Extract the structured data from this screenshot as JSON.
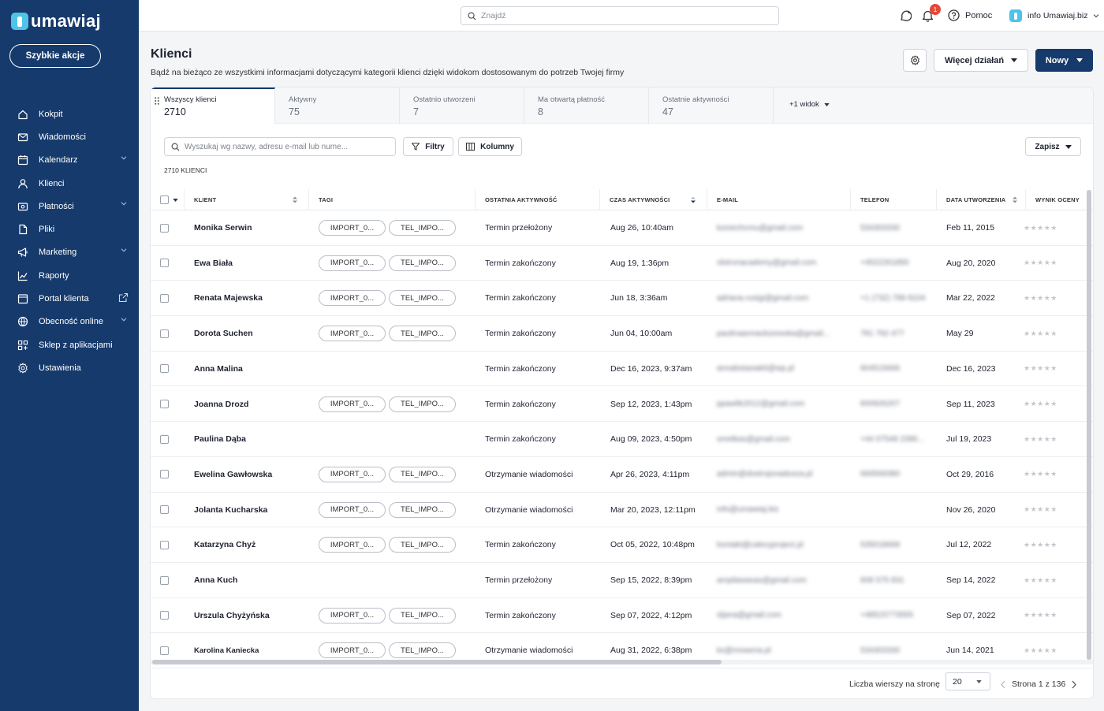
{
  "brand": {
    "name": "umawiaj"
  },
  "sidebar": {
    "quick_actions": "Szybkie akcje",
    "items": [
      {
        "label": "Kokpit",
        "icon": "home-icon"
      },
      {
        "label": "Wiadomości",
        "icon": "mail-icon"
      },
      {
        "label": "Kalendarz",
        "icon": "calendar-icon",
        "expandable": true
      },
      {
        "label": "Klienci",
        "icon": "user-icon"
      },
      {
        "label": "Płatności",
        "icon": "payment-icon",
        "expandable": true
      },
      {
        "label": "Pliki",
        "icon": "file-icon"
      },
      {
        "label": "Marketing",
        "icon": "megaphone-icon",
        "expandable": true
      },
      {
        "label": "Raporty",
        "icon": "chart-icon"
      },
      {
        "label": "Portal klienta",
        "icon": "portal-icon",
        "external": true
      },
      {
        "label": "Obecność online",
        "icon": "globe-icon",
        "expandable": true
      },
      {
        "label": "Sklep z aplikacjami",
        "icon": "apps-icon"
      },
      {
        "label": "Ustawienia",
        "icon": "gear-icon"
      }
    ]
  },
  "topbar": {
    "search_placeholder": "Znajdź",
    "notifications_count": "1",
    "help_label": "Pomoc",
    "account_label": "info Umawiaj.biz"
  },
  "header": {
    "title": "Klienci",
    "subtitle": "Bądź na bieżąco ze wszystkimi informacjami dotyczącymi kategorii klienci dzięki widokom dostosowanym do potrzeb Twojej firmy",
    "more_actions": "Więcej działań",
    "new_label": "Nowy"
  },
  "tabs": [
    {
      "label": "Wszyscy klienci",
      "count": "2710"
    },
    {
      "label": "Aktywny",
      "count": "75"
    },
    {
      "label": "Ostatnio utworzeni",
      "count": "7"
    },
    {
      "label": "Ma otwartą płatność",
      "count": "8"
    },
    {
      "label": "Ostatnie aktywności",
      "count": "47"
    }
  ],
  "tab_more": "+1 widok",
  "toolbar": {
    "search_placeholder": "Wyszukaj wg nazwy, adresu e-mail lub nume...",
    "filters": "Filtry",
    "columns": "Kolumny",
    "save": "Zapisz",
    "count_label": "2710 KLIENCI"
  },
  "table": {
    "headers": [
      "KLIENT",
      "TAGI",
      "OSTATNIA AKTYWNOŚĆ",
      "CZAS AKTYWNOŚCI",
      "E-MAIL",
      "TELEFON",
      "DATA UTWORZENIA",
      "WYNIK OCENY"
    ],
    "tag_a": "IMPORT_0...",
    "tag_b": "TEL_IMPO...",
    "stars": "★★★★★",
    "rows": [
      {
        "name": "Monika Serwin",
        "tags": true,
        "activity": "Termin przełożony",
        "time": "Aug 26, 10:40am",
        "email": "koniechcmu@gmail.com",
        "phone": "534303330",
        "created": "Feb 11, 2015"
      },
      {
        "name": "Ewa Biała",
        "tags": true,
        "activity": "Termin zakończony",
        "time": "Aug 19, 1:36pm",
        "email": "olstronacademy@gmail.com",
        "phone": "+4522261850",
        "created": "Aug 20, 2020"
      },
      {
        "name": "Renata Majewska",
        "tags": true,
        "activity": "Termin zakończony",
        "time": "Jun 18, 3:36am",
        "email": "adriana.rustgi@gmail.com",
        "phone": "+1 (732) 799-9104",
        "created": "Mar 22, 2022"
      },
      {
        "name": "Dorota Suchen",
        "tags": true,
        "activity": "Termin zakończony",
        "time": "Jun 04, 10:00am",
        "email": "paulinaannaolszewska@gmail...",
        "phone": "781 792 477",
        "created": "May 29"
      },
      {
        "name": "Anna Malina",
        "tags": false,
        "activity": "Termin zakończony",
        "time": "Dec 16, 2023, 9:37am",
        "email": "annabstasiak6@wp.pl",
        "phone": "604515666",
        "created": "Dec 16, 2023"
      },
      {
        "name": "Joanna Drozd",
        "tags": true,
        "activity": "Termin zakończony",
        "time": "Sep 12, 2023, 1:43pm",
        "email": "ppawlik2012@gmail.com",
        "phone": "600926207",
        "created": "Sep 11, 2023"
      },
      {
        "name": "Paulina Dąba",
        "tags": false,
        "activity": "Termin zakończony",
        "time": "Aug 09, 2023, 4:50pm",
        "email": "smetkas@gmail.com",
        "phone": "+44 07548 2390...",
        "created": "Jul 19, 2023"
      },
      {
        "name": "Ewelina Gawłowska",
        "tags": true,
        "activity": "Otrzymanie wiadomości",
        "time": "Apr 26, 2023, 4:11pm",
        "email": "admin@dostrojonadusza.pl",
        "phone": "666569380",
        "created": "Oct 29, 2016"
      },
      {
        "name": "Jolanta Kucharska",
        "tags": true,
        "activity": "Otrzymanie wiadomości",
        "time": "Mar 20, 2023, 12:11pm",
        "email": "info@umawiaj.biz",
        "phone": "",
        "created": "Nov 26, 2020"
      },
      {
        "name": "Katarzyna Chyż",
        "tags": true,
        "activity": "Termin zakończony",
        "time": "Oct 05, 2022, 10:48pm",
        "email": "kontakt@caloryproject.pl",
        "phone": "535018668",
        "created": "Jul 12, 2022"
      },
      {
        "name": "Anna Kuch",
        "tags": false,
        "activity": "Termin przełożony",
        "time": "Sep 15, 2022, 8:39pm",
        "email": "ampilawasas@gmail.com",
        "phone": "608 575 831",
        "created": "Sep 14, 2022"
      },
      {
        "name": "Urszula Chyżyńska",
        "tags": true,
        "activity": "Termin zakończony",
        "time": "Sep 07, 2022, 4:12pm",
        "email": "sljana@gmail.com",
        "phone": "+48515773555",
        "created": "Sep 07, 2022"
      },
      {
        "name": "Karolina Kaniecka",
        "tags": true,
        "activity": "Otrzymanie wiadomości",
        "time": "Aug 31, 2022, 6:38pm",
        "email": "ks@mowena.pl",
        "phone": "534303330",
        "created": "Jun 14, 2021"
      }
    ]
  },
  "footer": {
    "rows_per_page_label": "Liczba wierszy na stronę",
    "rows_per_page": "20",
    "page_label": "Strona 1 z 136"
  }
}
